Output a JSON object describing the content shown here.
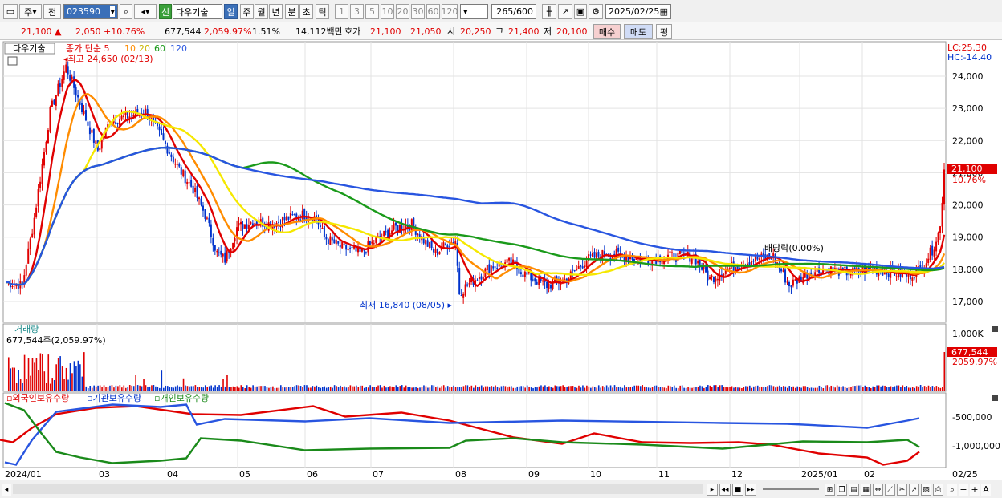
{
  "toolbar": {
    "period_type": "주",
    "compare": "전",
    "code": "023590",
    "name_badge": "신",
    "stock_name": "다우기술",
    "periods": [
      "일",
      "주",
      "월",
      "년",
      "분",
      "초",
      "틱"
    ],
    "intervals": [
      "1",
      "3",
      "5",
      "10",
      "20",
      "30",
      "60",
      "120"
    ],
    "count": "265",
    "count_max": "/600",
    "date": "2025/02/25"
  },
  "info": {
    "price": "21,100",
    "arrow": "▲",
    "change": "2,050",
    "change_pct": "+10.76%",
    "volume": "677,544",
    "volume_pct": "2,059.97%",
    "turnover": "1.51%",
    "amount": "14,112백만",
    "quote_label": "호가",
    "ask": "21,100",
    "bid": "21,050",
    "open_label": "시",
    "open": "20,250",
    "high_label": "고",
    "high": "21,400",
    "low_label": "저",
    "low": "20,100",
    "buy": "매수",
    "sell": "매도",
    "avg": "평"
  },
  "price_panel": {
    "legend_name": "다우기술",
    "legend_ma": "종가 단순 5",
    "ma10": "10",
    "ma20": "20",
    "ma60": "60",
    "ma120": "120",
    "lc": "LC:25.30",
    "hc": "HC:-14.40",
    "high_marker": "최고 24,650 (02/13)",
    "low_marker": "최저 16,840 (08/05)",
    "dividend": "배당락(0.00%)",
    "yticks": [
      "24,000",
      "23,000",
      "22,000",
      "21,000",
      "20,000",
      "19,000",
      "18,000",
      "17,000"
    ],
    "last_price": "21,100",
    "last_pct": "10.76%"
  },
  "volume_panel": {
    "title": "거래량",
    "value": "677,544주(2,059.97%)",
    "ytick": "1,000K",
    "last": "677,544",
    "last_pct": "2059.97%"
  },
  "holders_panel": {
    "foreign": "외국인보유수량",
    "inst": "기관보유수량",
    "indiv": "개인보유수량",
    "yticks": [
      "-500,000",
      "-1,000,000"
    ]
  },
  "xaxis": {
    "labels": [
      "2024/01",
      "03",
      "04",
      "05",
      "06",
      "07",
      "08",
      "09",
      "10",
      "11",
      "12",
      "2025/01",
      "02",
      "02/25"
    ]
  },
  "colors": {
    "up": "#e00000",
    "down": "#0033cc",
    "ma5": "#e00000",
    "ma10": "#ff8c00",
    "ma20": "#f5e800",
    "ma60": "#1a9a1a",
    "ma120": "#2855e0"
  }
}
